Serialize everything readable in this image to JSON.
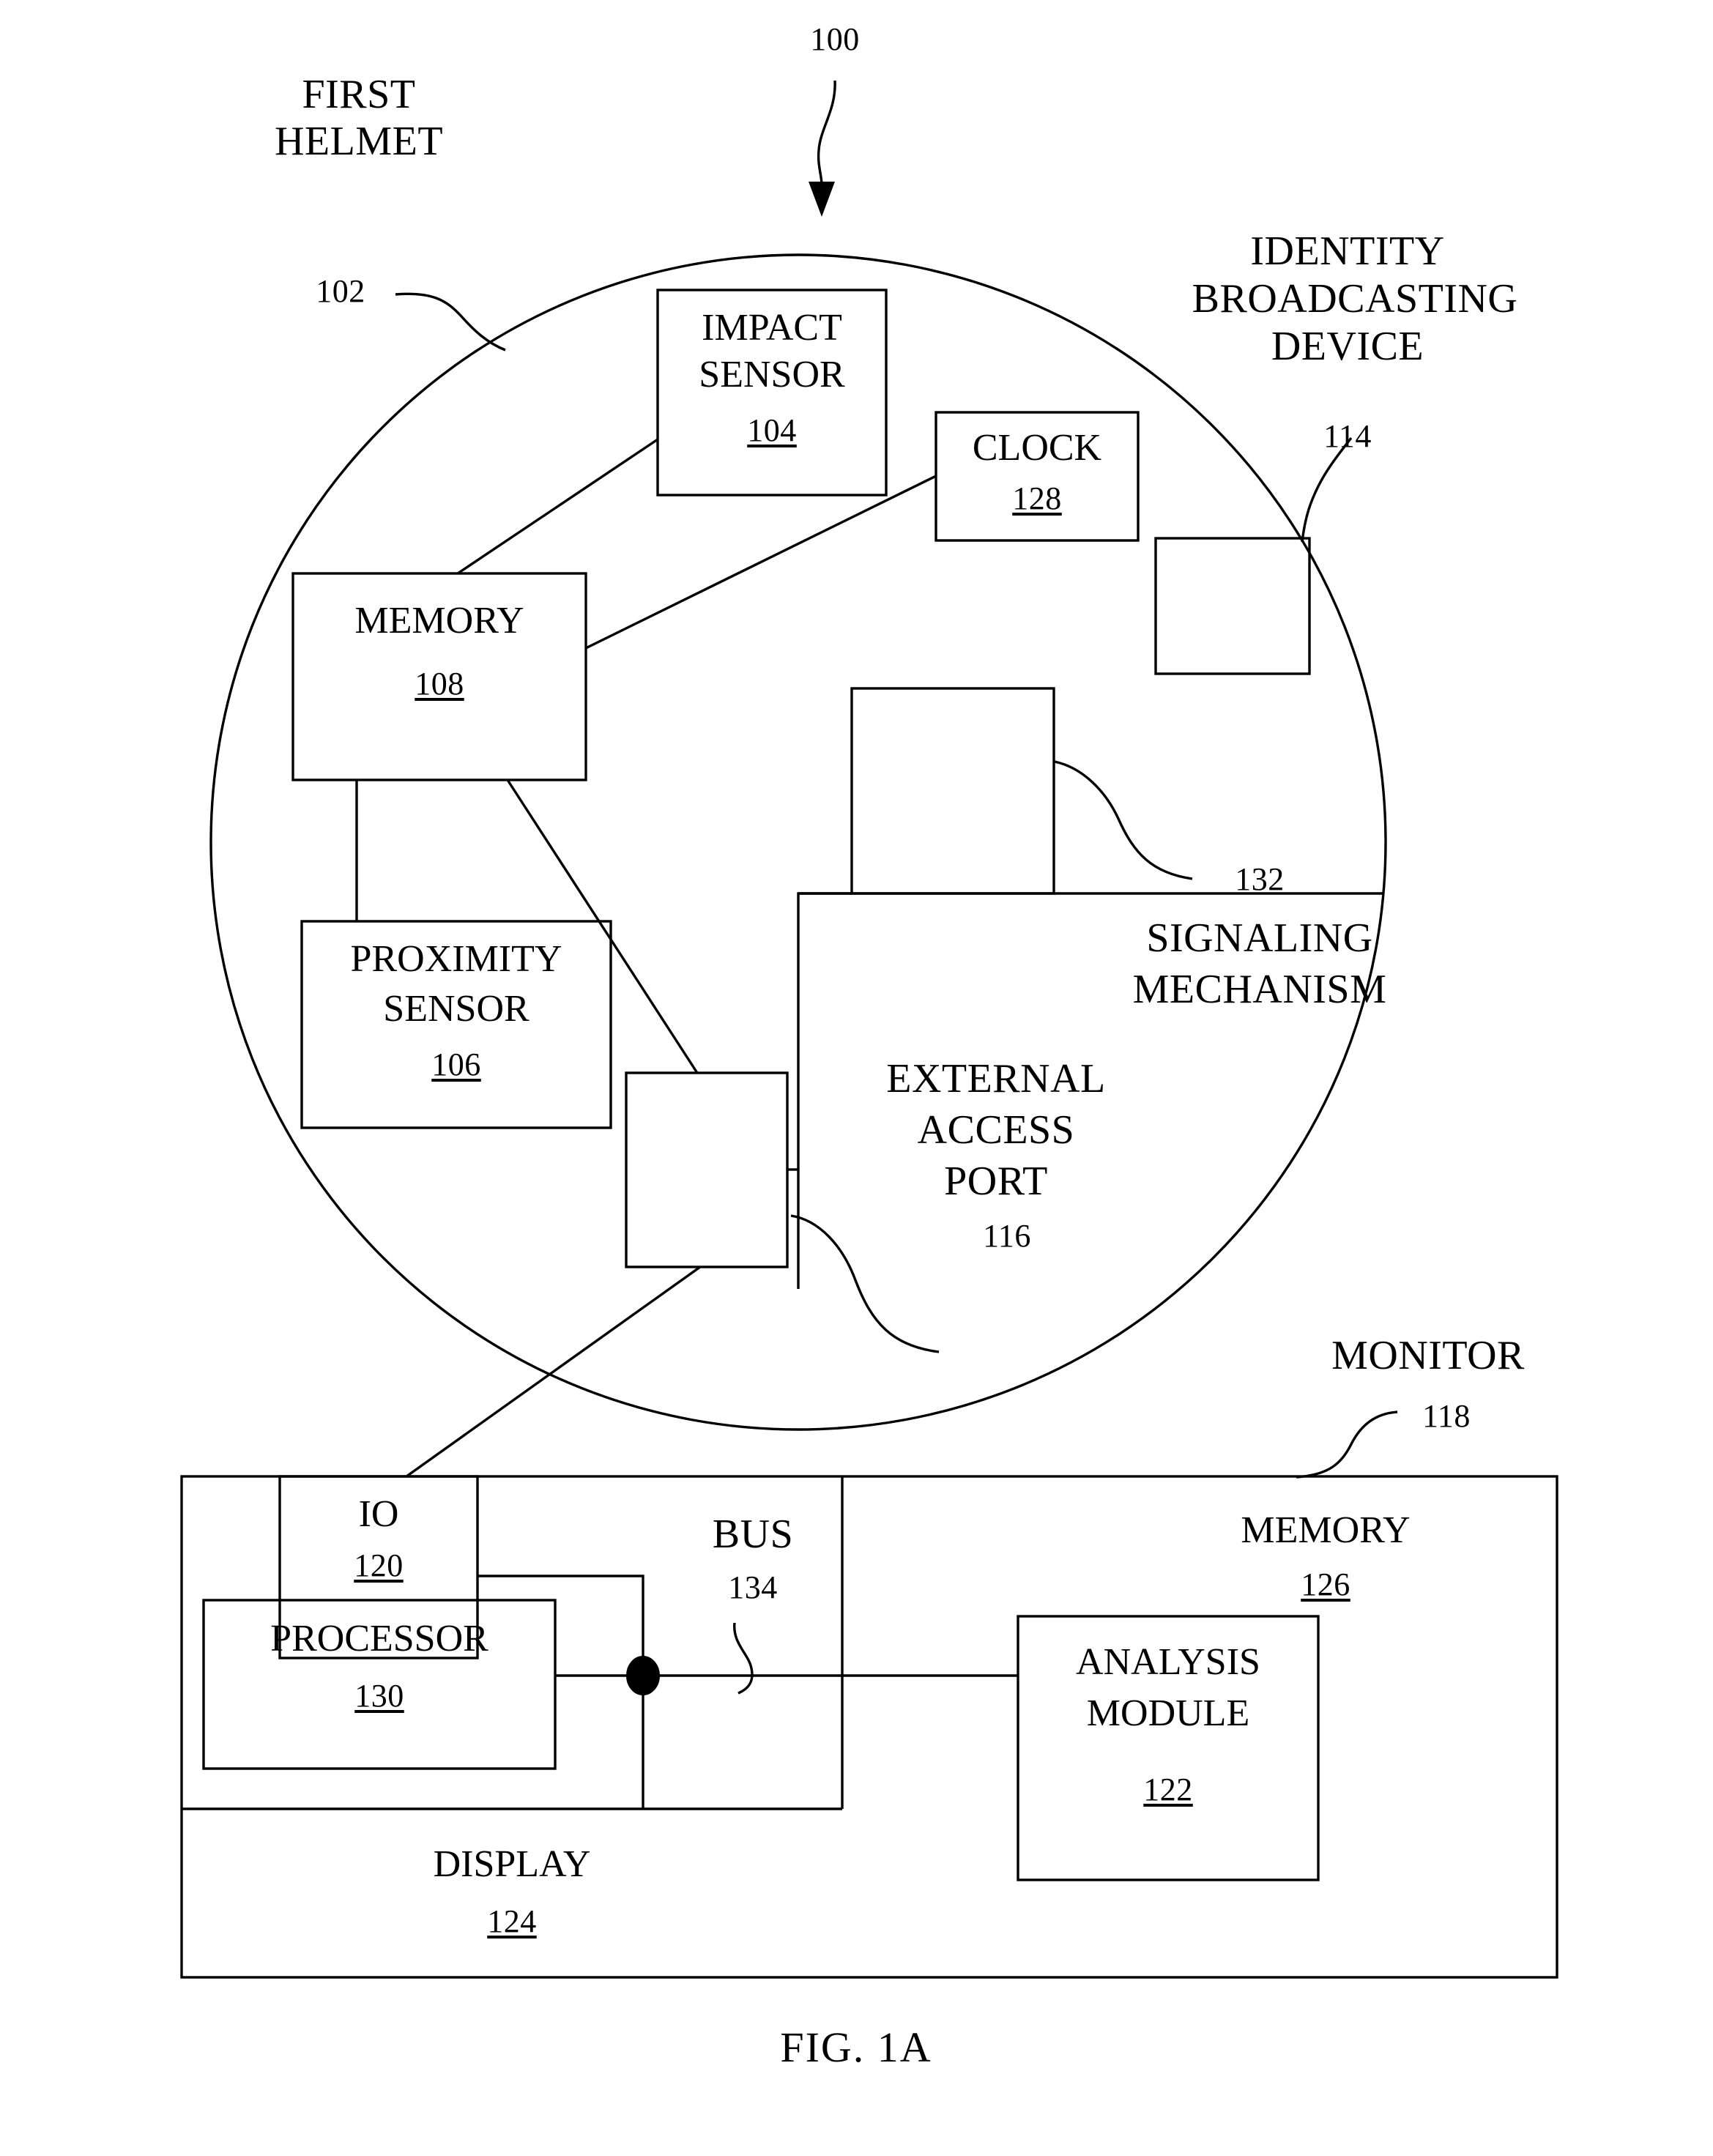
{
  "figure": {
    "caption": "FIG. 1A",
    "system_ref": "100"
  },
  "helmet": {
    "title_line1": "FIRST",
    "title_line2": "HELMET",
    "ref": "102",
    "components": [
      {
        "name": "impact-sensor",
        "line1": "IMPACT",
        "line2": "SENSOR",
        "ref": "104"
      },
      {
        "name": "clock",
        "line1": "CLOCK",
        "line2": "",
        "ref": "128"
      },
      {
        "name": "memory",
        "line1": "MEMORY",
        "line2": "",
        "ref": "108"
      },
      {
        "name": "proximity-sensor",
        "line1": "PROXIMITY",
        "line2": "SENSOR",
        "ref": "106"
      }
    ]
  },
  "identity_broadcasting_device": {
    "line1": "IDENTITY",
    "line2": "BROADCASTING",
    "line3": "DEVICE",
    "ref": "114"
  },
  "signaling_mechanism": {
    "line1": "SIGNALING",
    "line2": "MECHANISM",
    "ref": "132"
  },
  "external_access_port": {
    "line1": "EXTERNAL",
    "line2": "ACCESS",
    "line3": "PORT",
    "ref": "116"
  },
  "monitor": {
    "title": "MONITOR",
    "ref": "118",
    "bus": {
      "label": "BUS",
      "ref": "134"
    },
    "components": [
      {
        "name": "io",
        "line1": "IO",
        "line2": "",
        "ref": "120"
      },
      {
        "name": "processor",
        "line1": "PROCESSOR",
        "line2": "",
        "ref": "130"
      },
      {
        "name": "display",
        "line1": "DISPLAY",
        "line2": "",
        "ref": "124"
      },
      {
        "name": "memory",
        "line1": "MEMORY",
        "line2": "",
        "ref": "126"
      },
      {
        "name": "analysis-module",
        "line1": "ANALYSIS",
        "line2": "MODULE",
        "ref": "122"
      }
    ]
  },
  "colors": {
    "ink": "#000000",
    "paper": "#ffffff"
  }
}
